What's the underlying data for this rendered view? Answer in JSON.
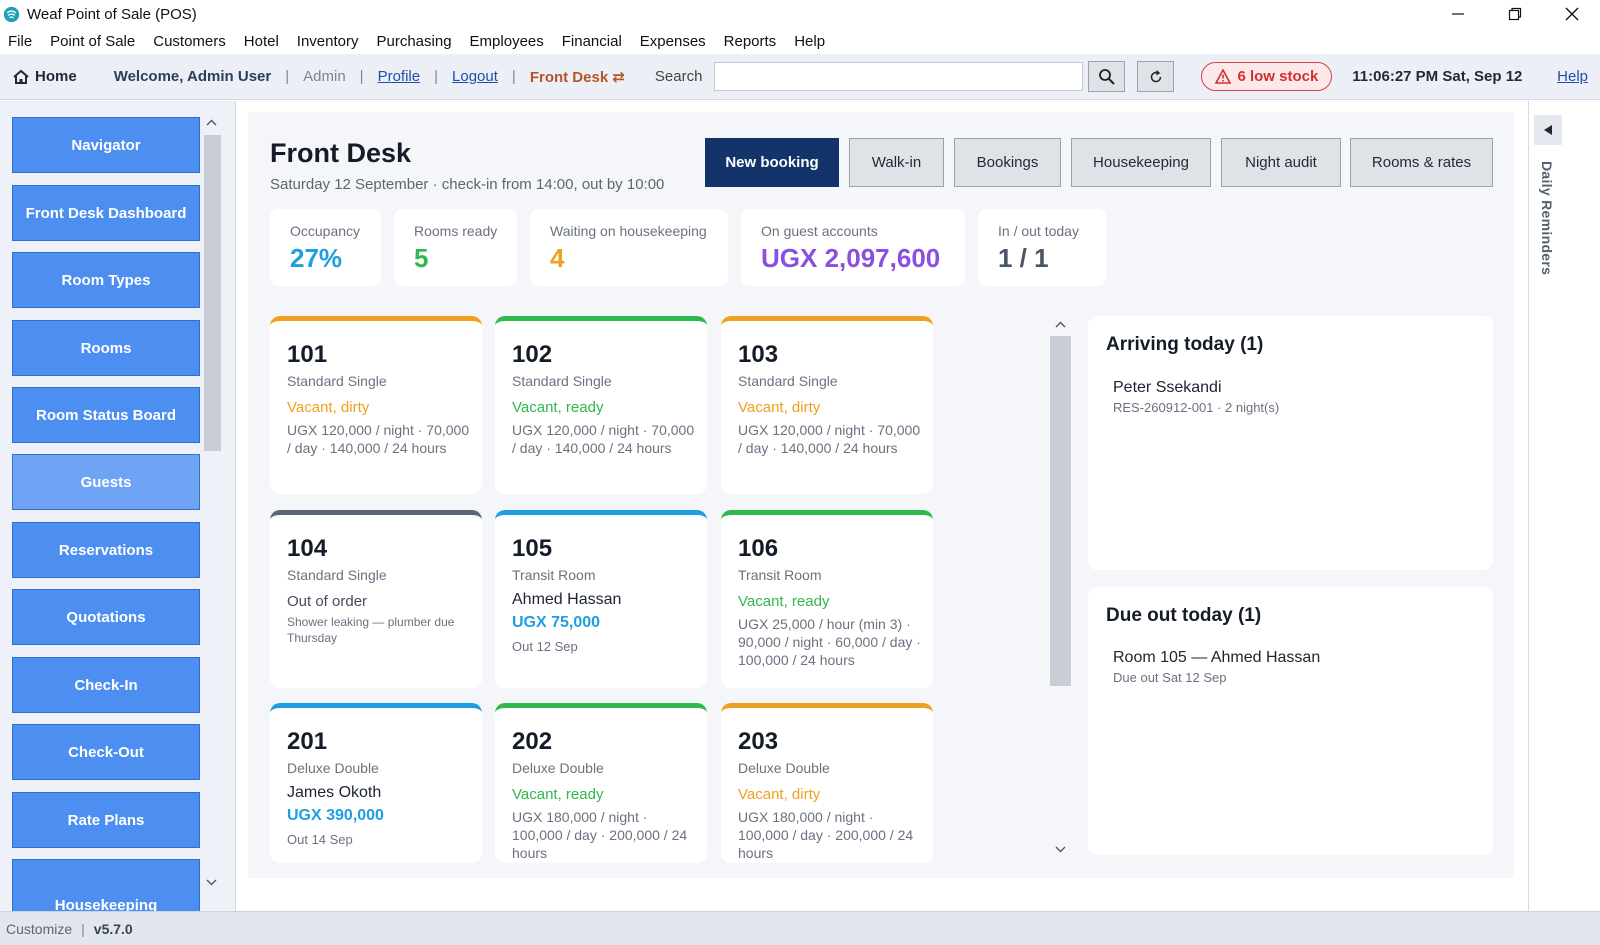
{
  "window": {
    "title": "Weaf Point of Sale (POS)"
  },
  "menu": [
    "File",
    "Point of Sale",
    "Customers",
    "Hotel",
    "Inventory",
    "Purchasing",
    "Employees",
    "Financial",
    "Expenses",
    "Reports",
    "Help"
  ],
  "toolbar": {
    "home": "Home",
    "welcome": "Welcome, Admin User",
    "admin": "Admin",
    "profile": "Profile",
    "logout": "Logout",
    "front_desk": "Front Desk ⇄",
    "search_label": "Search",
    "search_value": "",
    "low_stock": "6 low stock",
    "clock": "11:06:27 PM Sat, Sep 12",
    "help": "Help",
    "separator": "|"
  },
  "sidebar": {
    "items": [
      "Navigator",
      "Front Desk Dashboard",
      "Room Types",
      "Rooms",
      "Room Status Board",
      "Guests",
      "Reservations",
      "Quotations",
      "Check-In",
      "Check-Out",
      "Rate Plans",
      "Housekeeping"
    ]
  },
  "page": {
    "title": "Front Desk",
    "subtitle": "Saturday 12 September  ·  check-in from 14:00, out by 10:00"
  },
  "actions": [
    "New booking",
    "Walk-in",
    "Bookings",
    "Housekeeping",
    "Night audit",
    "Rooms & rates"
  ],
  "kpis": [
    {
      "label": "Occupancy",
      "value": "27%",
      "color": "#1e9fe0"
    },
    {
      "label": "Rooms ready",
      "value": "5",
      "color": "#2fb84c"
    },
    {
      "label": "Waiting on housekeeping",
      "value": "4",
      "color": "#f0a020"
    },
    {
      "label": "On guest accounts",
      "value": "UGX 2,097,600",
      "color": "#8a4fe0"
    },
    {
      "label": "In / out today",
      "value": "1 / 1",
      "color": "#4a5568"
    }
  ],
  "rooms": [
    {
      "number": "101",
      "type": "Standard Single",
      "status": "Vacant, dirty",
      "rate": "UGX 120,000 / night · 70,000 / day · 140,000 / 24 hours"
    },
    {
      "number": "102",
      "type": "Standard Single",
      "status": "Vacant, ready",
      "rate": "UGX 120,000 / night · 70,000 / day · 140,000 / 24 hours"
    },
    {
      "number": "103",
      "type": "Standard Single",
      "status": "Vacant, dirty",
      "rate": "UGX 120,000 / night · 70,000 / day · 140,000 / 24 hours"
    },
    {
      "number": "104",
      "type": "Standard Single",
      "status": "Out of order",
      "note": "Shower leaking — plumber due Thursday"
    },
    {
      "number": "105",
      "type": "Transit Room",
      "guest": "Ahmed Hassan",
      "amount": "UGX 75,000",
      "out": "Out 12 Sep"
    },
    {
      "number": "106",
      "type": "Transit Room",
      "status": "Vacant, ready",
      "rate": "UGX 25,000 / hour (min 3) · 90,000 / night · 60,000 / day · 100,000 / 24 hours"
    },
    {
      "number": "201",
      "type": "Deluxe Double",
      "guest": "James Okoth",
      "amount": "UGX 390,000",
      "out": "Out 14 Sep"
    },
    {
      "number": "202",
      "type": "Deluxe Double",
      "status": "Vacant, ready",
      "rate": "UGX 180,000 / night · 100,000 / day · 200,000 / 24 hours"
    },
    {
      "number": "203",
      "type": "Deluxe Double",
      "status": "Vacant, dirty",
      "rate": "UGX 180,000 / night · 100,000 / day · 200,000 / 24 hours"
    }
  ],
  "arriving": {
    "title": "Arriving today (1)",
    "guest": "Peter Ssekandi",
    "detail": "RES-260912-001  ·  2  night(s)"
  },
  "due_out": {
    "title": "Due out today (1)",
    "room": "Room  105  —  Ahmed Hassan",
    "detail": "Due out Sat 12 Sep"
  },
  "rail": {
    "label": "Daily Reminders"
  },
  "statusbar": {
    "customize": "Customize",
    "version": "v5.7.0"
  },
  "colors": {
    "dirty": "#f0a020",
    "ready": "#2fb84c",
    "occupied": "#1e9fe0",
    "out_of_order": "#5b6677",
    "primary": "#13336b",
    "nav": "#4d8ff0"
  }
}
